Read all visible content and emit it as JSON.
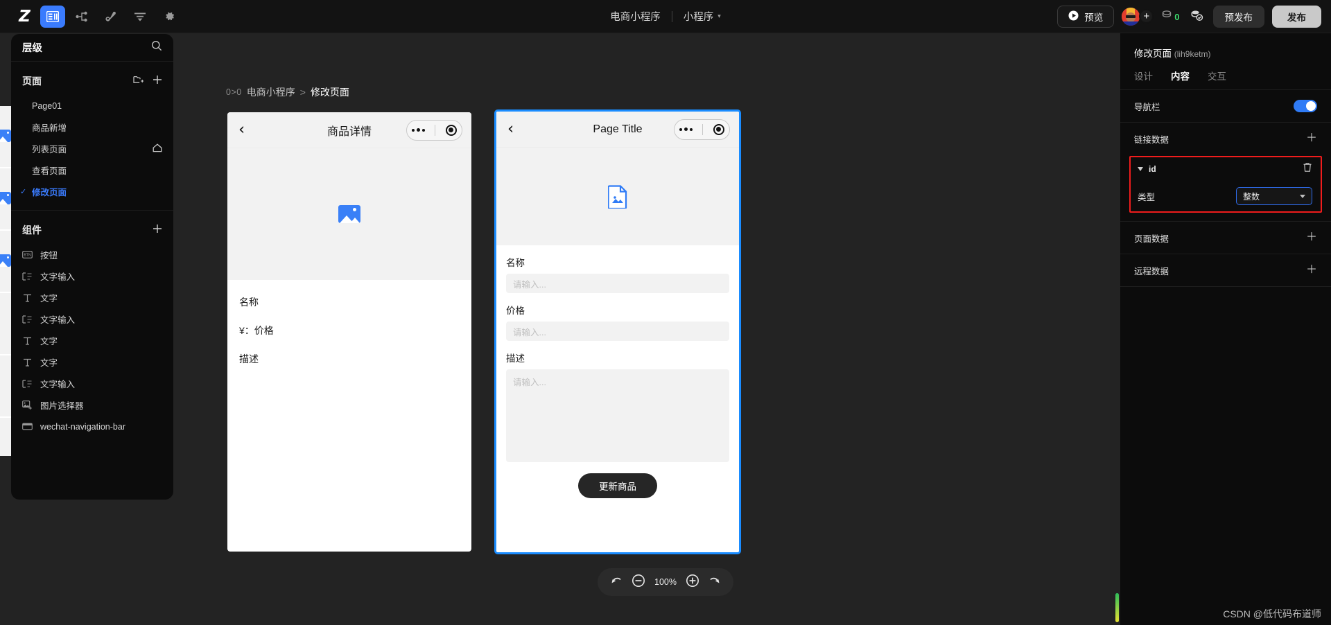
{
  "topbar": {
    "logo": "Z",
    "tools": [
      {
        "name": "layers-icon",
        "label": "图层",
        "active": true
      },
      {
        "name": "sitemap-icon",
        "label": "流程",
        "active": false
      },
      {
        "name": "plugin-icon",
        "label": "插件",
        "active": false
      },
      {
        "name": "align-icon",
        "label": "对齐",
        "active": false
      },
      {
        "name": "gear-icon",
        "label": "设置",
        "active": false
      }
    ],
    "project_name": "电商小程序",
    "project_type": "小程序",
    "preview_label": "预览",
    "coin_count": "0",
    "prepublish_label": "预发布",
    "publish_label": "发布"
  },
  "left_panel": {
    "title": "层级",
    "search_icon": "search-icon",
    "pages_section": {
      "title": "页面",
      "items": [
        {
          "label": "Page01",
          "active": false,
          "home": false
        },
        {
          "label": "商品新增",
          "active": false,
          "home": false
        },
        {
          "label": "列表页面",
          "active": false,
          "home": true
        },
        {
          "label": "查看页面",
          "active": false,
          "home": false
        },
        {
          "label": "修改页面",
          "active": true,
          "home": false
        }
      ]
    },
    "components_section": {
      "title": "组件",
      "items": [
        {
          "label": "按钮",
          "icon": "button-icon"
        },
        {
          "label": "文字输入",
          "icon": "text-input-icon"
        },
        {
          "label": "文字",
          "icon": "text-icon"
        },
        {
          "label": "文字输入",
          "icon": "text-input-icon"
        },
        {
          "label": "文字",
          "icon": "text-icon"
        },
        {
          "label": "文字",
          "icon": "text-icon"
        },
        {
          "label": "文字输入",
          "icon": "text-input-icon"
        },
        {
          "label": "图片选择器",
          "icon": "image-picker-icon"
        },
        {
          "label": "wechat-navigation-bar",
          "icon": "nav-bar-icon"
        }
      ]
    }
  },
  "canvas": {
    "breadcrumb": {
      "badge": "0>0",
      "project": "电商小程序",
      "separator": ">",
      "page": "修改页面"
    },
    "phone_left": {
      "nav_title": "商品详情",
      "back_icon": "chevron-left-icon",
      "lines": [
        "名称",
        "¥：价格",
        "描述"
      ]
    },
    "phone_right": {
      "nav_title": "Page Title",
      "back_icon": "chevron-left-icon",
      "fields": [
        {
          "label": "名称",
          "placeholder": "请输入...",
          "type": "input"
        },
        {
          "label": "价格",
          "placeholder": "请输入...",
          "type": "input"
        },
        {
          "label": "描述",
          "placeholder": "请输入...",
          "type": "textarea"
        }
      ],
      "submit_label": "更新商品"
    }
  },
  "right_panel": {
    "title": "修改页面",
    "title_id": "(lih9ketm)",
    "tabs": [
      {
        "label": "设计",
        "active": false
      },
      {
        "label": "内容",
        "active": true
      },
      {
        "label": "交互",
        "active": false
      }
    ],
    "navbar_row": {
      "label": "导航栏",
      "toggle_on": true
    },
    "link_data": {
      "label": "链接数据",
      "add_icon": "plus-icon"
    },
    "highlighted_param": {
      "name": "id",
      "delete_icon": "trash-icon",
      "type_label": "类型",
      "type_value": "整数",
      "border_color": "#f01c1c"
    },
    "page_data": {
      "label": "页面数据",
      "add_icon": "plus-icon"
    },
    "remote_data": {
      "label": "远程数据",
      "add_icon": "plus-icon"
    }
  },
  "zoombar": {
    "undo_icon": "undo-icon",
    "zoom_out_icon": "minus-circle-icon",
    "zoom_level": "100%",
    "zoom_in_icon": "plus-circle-icon",
    "redo_icon": "redo-icon"
  },
  "watermark": "CSDN @低代码布道师",
  "colors": {
    "accent_blue": "#3a7bfd",
    "selection_blue": "#1a8cff",
    "highlight_red": "#f01c1c",
    "panel_bg": "#0c0c0c",
    "canvas_bg": "#232323"
  }
}
